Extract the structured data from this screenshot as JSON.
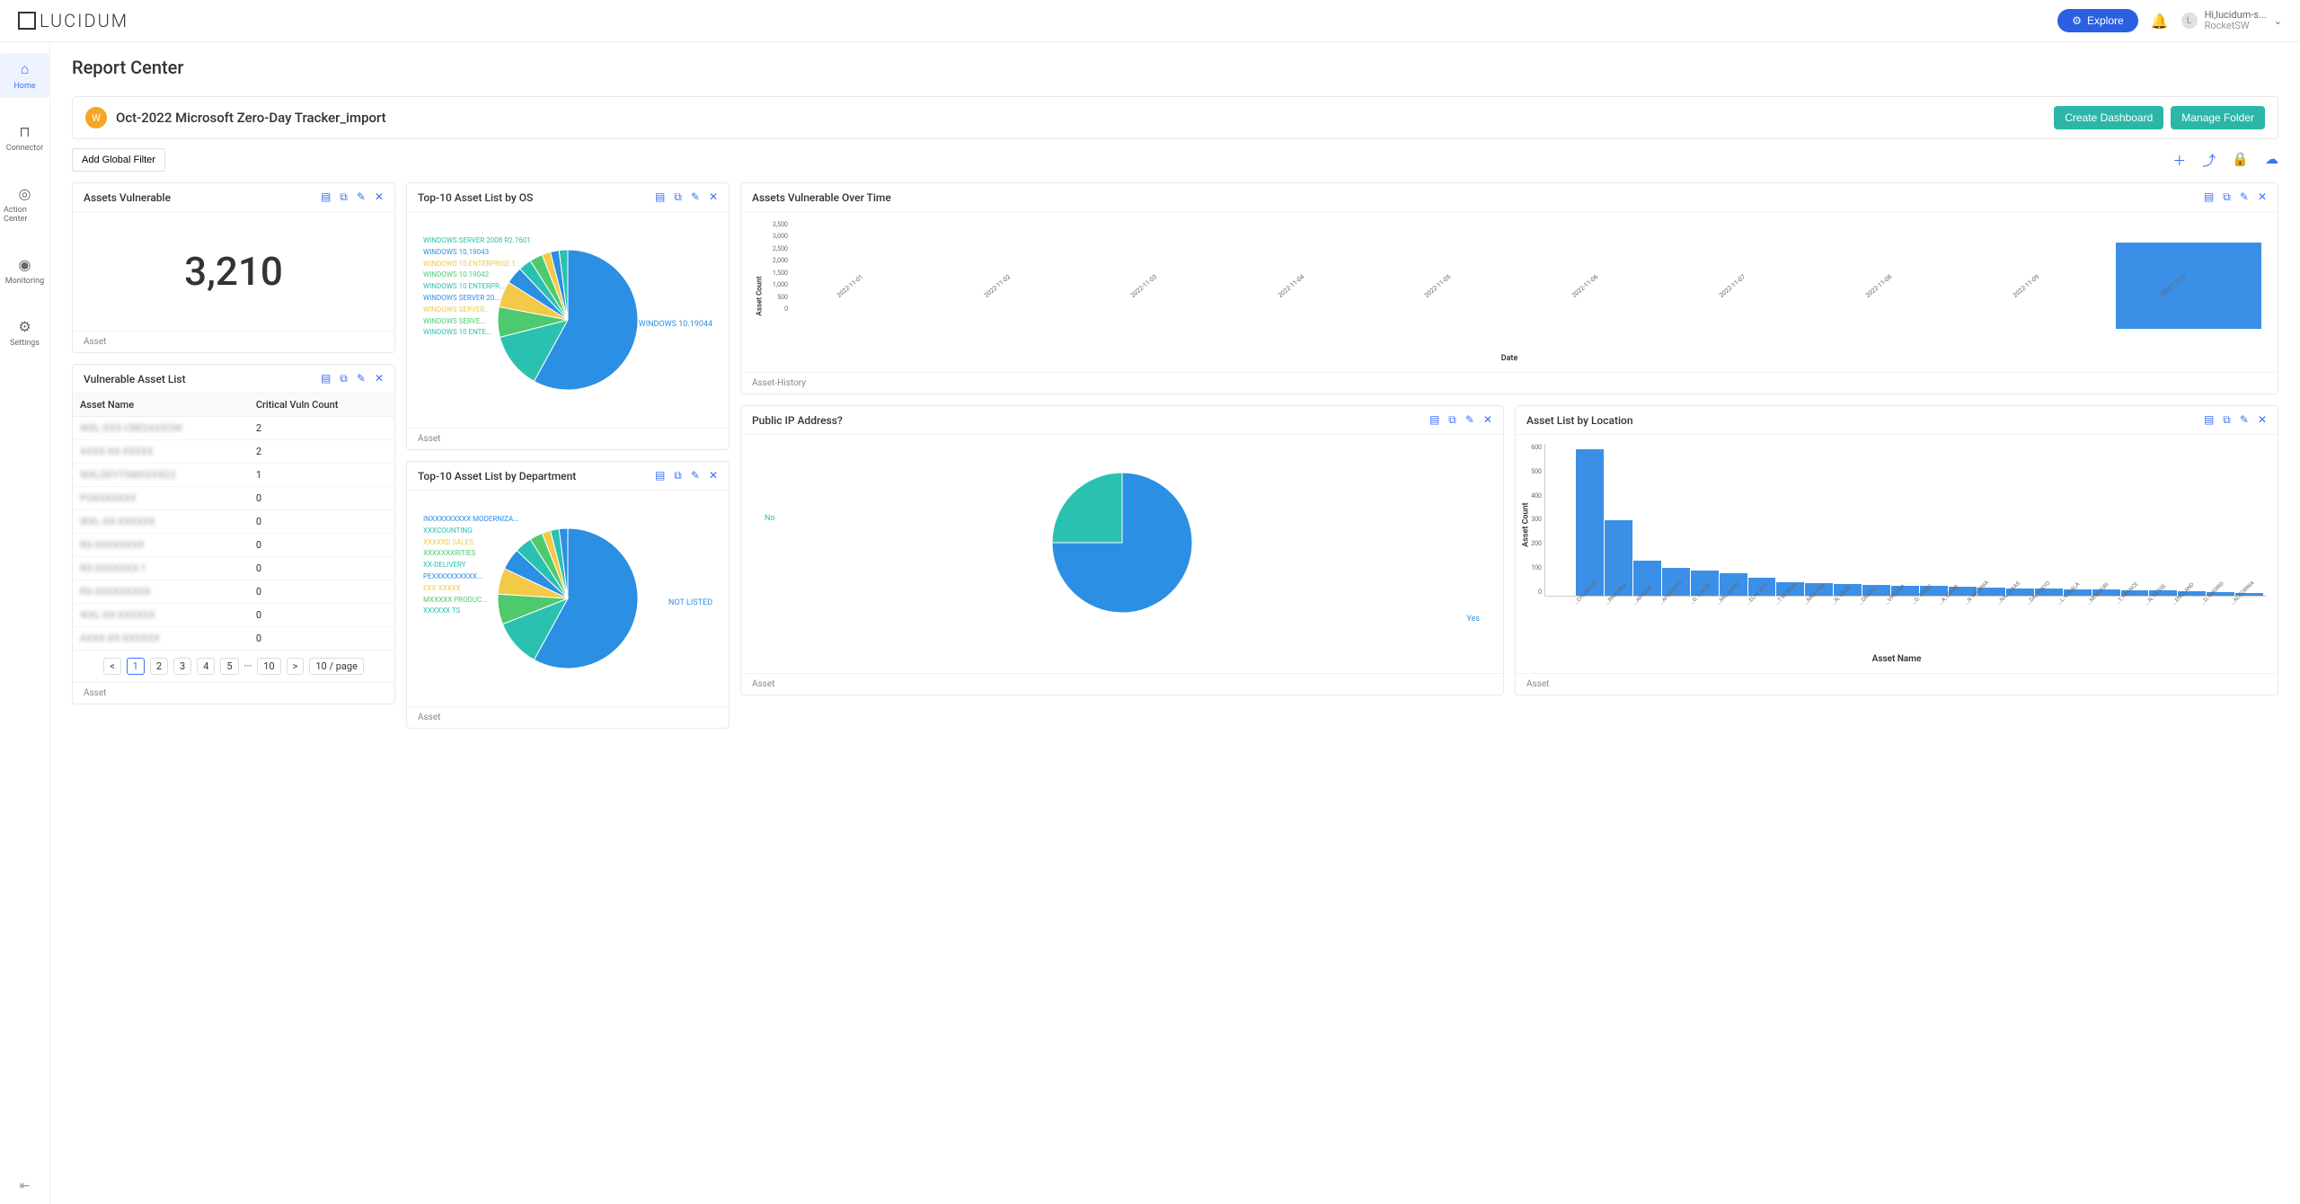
{
  "brand": "LUCIDUM",
  "header": {
    "explore_label": "Explore",
    "user_greeting": "Hi,lucidum-s...",
    "user_org": "RocketSW"
  },
  "sidebar": {
    "items": [
      {
        "label": "Home",
        "icon": "⌂"
      },
      {
        "label": "Connector",
        "icon": "⊓"
      },
      {
        "label": "Action Center",
        "icon": "◎"
      },
      {
        "label": "Monitoring",
        "icon": "◉"
      },
      {
        "label": "Settings",
        "icon": "⚙"
      }
    ]
  },
  "page": {
    "title": "Report Center",
    "report_badge": "W",
    "report_title": "Oct-2022 Microsoft Zero-Day Tracker_import",
    "create_dashboard_label": "Create Dashboard",
    "manage_folder_label": "Manage Folder",
    "add_filter_label": "Add Global Filter"
  },
  "panels": {
    "assets_vulnerable": {
      "title": "Assets Vulnerable",
      "value": "3,210",
      "footer": "Asset"
    },
    "vulnerable_list": {
      "title": "Vulnerable Asset List",
      "col1": "Asset Name",
      "col2": "Critical Vuln Count",
      "rows": [
        {
          "name": "WXL-XXX-CRESAXXOW",
          "count": "2"
        },
        {
          "name": "AXXX-XX-XXXXX",
          "count": "2"
        },
        {
          "name": "WXLDEVTSMXXXXD2",
          "count": "1"
        },
        {
          "name": "POXXXXXXX",
          "count": "0"
        },
        {
          "name": "WXL-XX-XXXXXX",
          "count": "0"
        },
        {
          "name": "RS-XXXXXXXX",
          "count": "0"
        },
        {
          "name": "RS-XXXXXXX-1",
          "count": "0"
        },
        {
          "name": "RS-XXXXXXXXX",
          "count": "0"
        },
        {
          "name": "WXL-XX-XXXXXX",
          "count": "0"
        },
        {
          "name": "AXXX-XX-XXXXXX",
          "count": "0"
        }
      ],
      "pagination": {
        "pages": [
          "1",
          "2",
          "3",
          "4",
          "5"
        ],
        "ellipsis": "···",
        "last": "10",
        "per_page": "10 / page"
      },
      "footer": "Asset"
    },
    "top10_os": {
      "title": "Top-10 Asset List by OS",
      "footer": "Asset",
      "dominant_label": "WINDOWS 10.19044",
      "labels": [
        "WINDOWS SERVER 2008 R2.7601",
        "WINDOWS 10.19043",
        "WINDOWS 10 ENTERPRISE 1...",
        "WINDOWS 10.19042",
        "WINDOWS 10 ENTERPR...",
        "WINDOWS SERVER 20...",
        "WINDOWS SERVER...",
        "WINDOWS SERVE...",
        "WINDOWS 10 ENTE..."
      ]
    },
    "top10_dept": {
      "title": "Top-10 Asset List by Department",
      "footer": "Asset",
      "dominant_label": "NOT LISTED",
      "labels": [
        "INXXXXXXXXX MODERNIZA...",
        "XXXCOUNTING",
        "XXXXXD SALES",
        "XXXXXXXRITIES",
        "XX-DELIVERY",
        "PEXXXXXXXXXX...",
        "EXX XXXXX",
        "MXXXXX PRODUC...",
        "XXXXXX TS"
      ]
    },
    "over_time": {
      "title": "Assets Vulnerable Over Time",
      "footer": "Asset-History",
      "ylabel": "Asset Count",
      "xlabel": "Date"
    },
    "public_ip": {
      "title": "Public IP Address?",
      "footer": "Asset",
      "no_label": "No",
      "yes_label": "Yes"
    },
    "by_location": {
      "title": "Asset List by Location",
      "footer": "Asset",
      "ylabel": "Asset Count",
      "xlabel": "Asset Name"
    }
  },
  "chart_data": [
    {
      "id": "top10_os",
      "type": "pie",
      "title": "Top-10 Asset List by OS",
      "series": [
        {
          "name": "WINDOWS 10.19044",
          "value": 58,
          "color": "#2b8fe3"
        },
        {
          "name": "WINDOWS 10 ENTE...",
          "value": 13,
          "color": "#2bc1b0"
        },
        {
          "name": "WINDOWS SERVE...",
          "value": 7,
          "color": "#4fc96e"
        },
        {
          "name": "WINDOWS SERVER...",
          "value": 6,
          "color": "#f3c948"
        },
        {
          "name": "WINDOWS SERVER 20...",
          "value": 4,
          "color": "#2b8fe3"
        },
        {
          "name": "WINDOWS 10 ENTERPR...",
          "value": 3,
          "color": "#2bc1b0"
        },
        {
          "name": "WINDOWS 10.19042",
          "value": 3,
          "color": "#4fc96e"
        },
        {
          "name": "WINDOWS 10 ENTERPRISE 1...",
          "value": 2,
          "color": "#f3c948"
        },
        {
          "name": "WINDOWS 10.19043",
          "value": 2,
          "color": "#2b8fe3"
        },
        {
          "name": "WINDOWS SERVER 2008 R2.7601",
          "value": 2,
          "color": "#2bc1b0"
        }
      ]
    },
    {
      "id": "top10_dept",
      "type": "pie",
      "title": "Top-10 Asset List by Department",
      "series": [
        {
          "name": "NOT LISTED",
          "value": 58,
          "color": "#2b8fe3"
        },
        {
          "name": "XXXXXX TS",
          "value": 11,
          "color": "#2bc1b0"
        },
        {
          "name": "MXXXXX PRODUC...",
          "value": 7,
          "color": "#4fc96e"
        },
        {
          "name": "EXX XXXXX",
          "value": 6,
          "color": "#f3c948"
        },
        {
          "name": "PEXXXXXXXXXX...",
          "value": 5,
          "color": "#2b8fe3"
        },
        {
          "name": "XX-DELIVERY",
          "value": 4,
          "color": "#2bc1b0"
        },
        {
          "name": "XXXXXXXRITIES",
          "value": 3,
          "color": "#4fc96e"
        },
        {
          "name": "XXXXXD SALES",
          "value": 2,
          "color": "#f3c948"
        },
        {
          "name": "XXXCOUNTING",
          "value": 2,
          "color": "#2bc1b0"
        },
        {
          "name": "INXXXXXXXXX MODERNIZA...",
          "value": 2,
          "color": "#2b8fe3"
        }
      ]
    },
    {
      "id": "over_time",
      "type": "bar",
      "title": "Assets Vulnerable Over Time",
      "xlabel": "Date",
      "ylabel": "Asset Count",
      "ylim": [
        0,
        3500
      ],
      "yticks": [
        0,
        500,
        1000,
        1500,
        2000,
        2500,
        3000,
        3500
      ],
      "categories": [
        "2022-11-01",
        "2022-11-02",
        "2022-11-03",
        "2022-11-04",
        "2022-11-05",
        "2022-11-06",
        "2022-11-07",
        "2022-11-08",
        "2022-11-09",
        "2022-11-10"
      ],
      "values": [
        0,
        0,
        0,
        0,
        0,
        0,
        0,
        0,
        0,
        2800
      ]
    },
    {
      "id": "public_ip",
      "type": "pie",
      "title": "Public IP Address?",
      "series": [
        {
          "name": "Yes",
          "value": 75,
          "color": "#2b8fe3"
        },
        {
          "name": "No",
          "value": 25,
          "color": "#2bc1b0"
        }
      ]
    },
    {
      "id": "by_location",
      "type": "bar",
      "title": "Asset List by Location",
      "xlabel": "Asset Name",
      "ylabel": "Asset Count",
      "ylim": [
        0,
        600
      ],
      "yticks": [
        0,
        100,
        200,
        300,
        400,
        500,
        600
      ],
      "categories": [
        "...CHUSETTS",
        "...RNATAKA",
        "...ARYANA",
        "...APSKRITIS",
        "...O, TOKYO",
        "...MIL NADU",
        "...ELHI, NCT",
        "...T BENGAL",
        "...RASHTRA",
        "...N, VAUD",
        "...ORADO",
        "...VIRGINIA",
        "...O, TEXAS",
        "...A, BIHAR",
        "...N VIRGINIA",
        "...NA, TEXAS",
        "...DA, TOKYO",
        "...L, KERALA",
        "...MISSOURI",
        "...T, FRANCE",
        "...N, HESSE",
        "...ENGLAND",
        "...D, MADRID",
        "...ALIFORNIA"
      ],
      "values": [
        580,
        300,
        140,
        110,
        100,
        90,
        70,
        55,
        50,
        45,
        42,
        40,
        38,
        35,
        33,
        30,
        28,
        26,
        24,
        22,
        20,
        18,
        15,
        12
      ]
    }
  ]
}
